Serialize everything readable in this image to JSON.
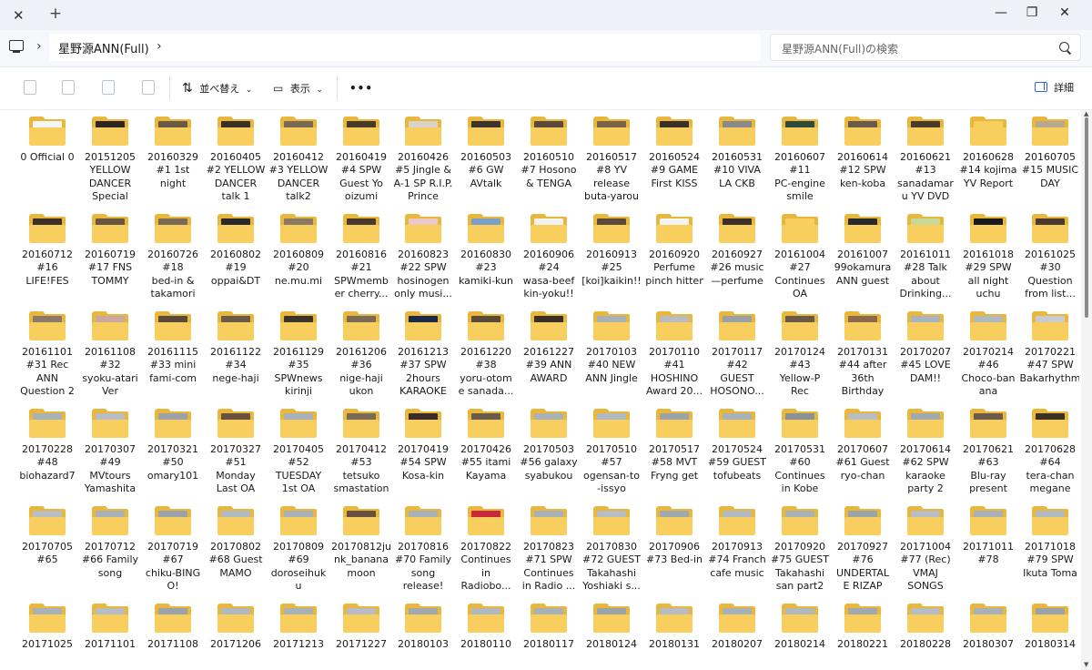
{
  "window": {
    "tab_close_icon": "close-icon",
    "new_tab_icon": "plus-icon",
    "minimize_icon": "minimize-icon",
    "restore_icon": "restore-icon",
    "close_icon": "close-icon"
  },
  "address": {
    "breadcrumb": "星野源ANN(Full)",
    "search_placeholder": "星野源ANN(Full)の検索"
  },
  "toolbar": {
    "sort_label": "並べ替え",
    "view_label": "表示",
    "more_label": "•••",
    "details_label": "詳細"
  },
  "rows": [
    [
      {
        "l": [
          "0 Official 0"
        ],
        "c": "#f6f6f6"
      },
      {
        "l": [
          "20151205",
          "YELLOW",
          "DANCER",
          "Special"
        ],
        "c": "#2c2620"
      },
      {
        "l": [
          "20160329",
          "#1  1st",
          "night"
        ],
        "c": "#6a5a45"
      },
      {
        "l": [
          "20160405",
          "#2 YELLOW",
          "DANCER",
          "talk 1"
        ],
        "c": "#3a3028"
      },
      {
        "l": [
          "20160412",
          "#3 YELLOW",
          "DANCER",
          "talk2"
        ],
        "c": "#7a6a55"
      },
      {
        "l": [
          "20160419",
          "#4 SPW",
          "Guest Yo",
          "oizumi"
        ],
        "c": "#4a3a2a"
      },
      {
        "l": [
          "20160426",
          "#5 Jingle &",
          "A-1 SP R.I.P.",
          "Prince"
        ],
        "c": "#d8d2c8"
      },
      {
        "l": [
          "20160503",
          "#6 GW",
          "AVtalk"
        ],
        "c": "#3a342c"
      },
      {
        "l": [
          "20160510",
          "#7  Hosono",
          "& TENGA"
        ],
        "c": "#5a4a3a"
      },
      {
        "l": [
          "20160517",
          "#8  YV",
          "release",
          "buta-yarou"
        ],
        "c": "#7a6548"
      },
      {
        "l": [
          "20160524",
          "#9  GAME",
          "First KISS"
        ],
        "c": "#3a3028"
      },
      {
        "l": [
          "20160531",
          "#10 VIVA",
          "LA  CKB"
        ],
        "c": "#8a8a8a"
      },
      {
        "l": [
          "20160607",
          "#11",
          "PC-engine",
          "smile"
        ],
        "c": "#2e4a3a"
      },
      {
        "l": [
          "20160614",
          "#12 SPW",
          "ken-koba"
        ],
        "c": "#6a5a4a"
      },
      {
        "l": [
          "20160621",
          "#13",
          "sanadamar",
          "u YV DVD"
        ],
        "c": "#4a3a2c"
      },
      {
        "l": [
          "20160628",
          "#14 kojima",
          "YV Report"
        ],
        "c": "#f8cf5e"
      },
      {
        "l": [
          "20160705",
          "#15  MUSIC",
          "DAY"
        ],
        "c": "#b8a890"
      }
    ],
    [
      {
        "l": [
          "20160712",
          "#16",
          "LIFE!FES"
        ],
        "c": "#3a3026"
      },
      {
        "l": [
          "20160719",
          "#17   FNS",
          "TOMMY"
        ],
        "c": "#6a5540"
      },
      {
        "l": [
          "20160726",
          "#18",
          "bed-in &",
          "takamori"
        ],
        "c": "#7a6a55"
      },
      {
        "l": [
          "20160802",
          "#19",
          "oppai&DT"
        ],
        "c": "#2a2a2a"
      },
      {
        "l": [
          "20160809",
          "#20",
          "ne.mu.mi"
        ],
        "c": "#8a7a65"
      },
      {
        "l": [
          "20160816",
          "#21",
          "SPWmemb",
          "er  cherry..."
        ],
        "c": "#4a3a2e"
      },
      {
        "l": [
          "20160823",
          "#22 SPW",
          "hosinogen",
          "only musi..."
        ],
        "c": "#e8c8c8"
      },
      {
        "l": [
          "20160830",
          "#23",
          "kamiki-kun"
        ],
        "c": "#7aa0c8"
      },
      {
        "l": [
          "20160906",
          "#24",
          "wasa-beef",
          "kin-yoku!!"
        ],
        "c": "#f2f2f2"
      },
      {
        "l": [
          "20160913",
          "#25",
          "[koi]kaikin!!"
        ],
        "c": "#5a4a3a"
      },
      {
        "l": [
          "20160920",
          "Perfume",
          "pinch hitter"
        ],
        "c": "#f4f4f4"
      },
      {
        "l": [
          "20160927",
          "#26  music",
          "—perfume"
        ],
        "c": "#3a3028"
      },
      {
        "l": [
          "20161004",
          "#27",
          "Continues",
          "OA"
        ],
        "c": "#f8cf5e"
      },
      {
        "l": [
          "20161007",
          "99okamura",
          "ANN  guest"
        ],
        "c": "#2a2a2a"
      },
      {
        "l": [
          "20161011",
          "#28 Talk",
          "about",
          "Drinking..."
        ],
        "c": "#c8d898"
      },
      {
        "l": [
          "20161018",
          "#29   SPW",
          "all night",
          "uchu"
        ],
        "c": "#1a1a1a"
      },
      {
        "l": [
          "20161025",
          "#30",
          "Question",
          "from list..."
        ],
        "c": "#4a3a30"
      }
    ],
    [
      {
        "l": [
          "20161101",
          "#31     Rec",
          "ANN",
          "Question 2"
        ],
        "c": "#8a7a68"
      },
      {
        "l": [
          "20161108",
          "#32",
          "syoku-atari",
          "Ver"
        ],
        "c": "#c8a8a0"
      },
      {
        "l": [
          "20161115",
          "#33  mini",
          "fami-com"
        ],
        "c": "#5a4a3a"
      },
      {
        "l": [
          "20161122",
          "#34",
          "nege-haji"
        ],
        "c": "#6a5a48"
      },
      {
        "l": [
          "20161129",
          "#35",
          "SPWnews",
          "kirinji"
        ],
        "c": "#3a342c"
      },
      {
        "l": [
          "20161206",
          "#36",
          "nige-haji",
          "ukon"
        ],
        "c": "#7a6a58"
      },
      {
        "l": [
          "20161213",
          "#37  SPW",
          "2hours",
          "KARAOKE"
        ],
        "c": "#1a2a4a"
      },
      {
        "l": [
          "20161220",
          "#38",
          "yoru-otom",
          "e sanada..."
        ],
        "c": "#5a4a3a"
      },
      {
        "l": [
          "20161227",
          "#39  ANN",
          "AWARD"
        ],
        "c": "#3a3026"
      },
      {
        "l": [
          "20170103",
          "#40  NEW",
          "ANN Jingle"
        ],
        "c": "#a8b0b8"
      },
      {
        "l": [
          "20170110",
          "#41",
          "HOSHINO",
          "Award 20..."
        ],
        "c": "#b8bcc0"
      },
      {
        "l": [
          "20170117",
          "#42",
          "GUEST",
          "HOSONO..."
        ],
        "c": "#9aa0a8"
      },
      {
        "l": [
          "20170124",
          "#43",
          "Yellow-P",
          "Rec"
        ],
        "c": "#6a5a4a"
      },
      {
        "l": [
          "20170131",
          "#44  after",
          "36th",
          "Birthday"
        ],
        "c": "#8a6a4a"
      },
      {
        "l": [
          "20170207",
          "#45  LOVE",
          "DAM!!"
        ],
        "c": "#a8b4c0"
      },
      {
        "l": [
          "20170214",
          "#46",
          "Choco-ban",
          "ana"
        ],
        "c": "#b0b8c0"
      },
      {
        "l": [
          "20170221",
          "#47  SPW",
          "Bakarhythm"
        ],
        "c": "#c8ccd2"
      }
    ],
    [
      {
        "l": [
          "20170228",
          "#48",
          "biohazard7"
        ],
        "c": "#a8b0b8"
      },
      {
        "l": [
          "20170307",
          "#49",
          "MVtours",
          "Yamashita"
        ],
        "c": "#b8bcc4"
      },
      {
        "l": [
          "20170321",
          "#50",
          "omary101"
        ],
        "c": "#9aa2aa"
      },
      {
        "l": [
          "20170327",
          "#51",
          "Monday",
          "Last OA"
        ],
        "c": "#6a5040"
      },
      {
        "l": [
          "20170405",
          "#52",
          "TUESDAY",
          "1st OA"
        ],
        "c": "#a8b0b8"
      },
      {
        "l": [
          "20170412",
          "#53",
          "tetsuko",
          "smastation"
        ],
        "c": "#7a6a58"
      },
      {
        "l": [
          "20170419",
          "#54  SPW",
          "Kosa-kin"
        ],
        "c": "#3a2a2a"
      },
      {
        "l": [
          "20170426",
          "#55  itami",
          "Kayama"
        ],
        "c": "#6a5a4a"
      },
      {
        "l": [
          "20170503",
          "#56  galaxy",
          "syabukou"
        ],
        "c": "#a8b0b8"
      },
      {
        "l": [
          "20170510",
          "#57",
          "ogensan-to",
          "-issyo"
        ],
        "c": "#b0b8c0"
      },
      {
        "l": [
          "20170517",
          "#58  MVT",
          "Fryng get"
        ],
        "c": "#9aa2aa"
      },
      {
        "l": [
          "20170524",
          "#59  GUEST",
          "tofubeats"
        ],
        "c": "#a8b0b8"
      },
      {
        "l": [
          "20170531",
          "#60",
          "Continues",
          "in Kobe"
        ],
        "c": "#8a9098"
      },
      {
        "l": [
          "20170607",
          "#61 Guest",
          "ryo-chan"
        ],
        "c": "#b8bcc4"
      },
      {
        "l": [
          "20170614",
          "#62 SPW",
          "karaoke",
          "party 2"
        ],
        "c": "#a0a8b0"
      },
      {
        "l": [
          "20170621",
          "#63",
          "Blu-ray",
          "present"
        ],
        "c": "#6a5a4a"
      },
      {
        "l": [
          "20170628",
          "#64",
          "tera-chan",
          "megane"
        ],
        "c": "#3a3026"
      }
    ],
    [
      {
        "l": [
          "20170705",
          "#65"
        ],
        "c": "#b8bcc4"
      },
      {
        "l": [
          "20170712",
          "#66 Family",
          "song"
        ],
        "c": "#a8b0b8"
      },
      {
        "l": [
          "20170719",
          "#67",
          "chiku-BING",
          "O!"
        ],
        "c": "#9aa2aa"
      },
      {
        "l": [
          "20170802",
          "#68 Guest",
          "MAMO"
        ],
        "c": "#b0b8c0"
      },
      {
        "l": [
          "20170809",
          "#69",
          "doroseihuk",
          "u"
        ],
        "c": "#a8b0b8"
      },
      {
        "l": [
          "20170812ju",
          "nk_banana",
          "moon"
        ],
        "c": "#6a5040"
      },
      {
        "l": [
          "20170816",
          "#70  Family",
          "song",
          "release!"
        ],
        "c": "#a8b0b8"
      },
      {
        "l": [
          "20170822",
          "Continues",
          "in",
          "Radiobo..."
        ],
        "c": "#c8283a"
      },
      {
        "l": [
          "20170823",
          "#71 SPW",
          "Continues",
          "in Radio ..."
        ],
        "c": "#a8b0b8"
      },
      {
        "l": [
          "20170830",
          "#72  GUEST",
          "Takahashi",
          "Yoshiaki s..."
        ],
        "c": "#b8bcc4"
      },
      {
        "l": [
          "20170906",
          "#73 Bed-in"
        ],
        "c": "#a0a8b0"
      },
      {
        "l": [
          "20170913",
          "#74 Franch",
          "cafe music"
        ],
        "c": "#b0b8c0"
      },
      {
        "l": [
          "20170920",
          "#75 GUEST",
          "Takahashi",
          "san part2"
        ],
        "c": "#a8b0b8"
      },
      {
        "l": [
          "20170927",
          "#76",
          "UNDERTAL",
          "E RIZAP"
        ],
        "c": "#9aa2aa"
      },
      {
        "l": [
          "20171004",
          "#77  (Rec)",
          "VMAJ",
          "SONGS"
        ],
        "c": "#b8bcc4"
      },
      {
        "l": [
          "20171011",
          "#78"
        ],
        "c": "#a8b0b8"
      },
      {
        "l": [
          "20171018",
          "#79  SPW",
          "Ikuta Toma"
        ],
        "c": "#b0b8c0"
      }
    ],
    [
      {
        "l": [
          "20171025"
        ],
        "c": "#a8b0b8"
      },
      {
        "l": [
          "20171101"
        ],
        "c": "#b8bcc4"
      },
      {
        "l": [
          "20171108"
        ],
        "c": "#9aa2aa"
      },
      {
        "l": [
          "20171206"
        ],
        "c": "#b0b8c0"
      },
      {
        "l": [
          "20171213"
        ],
        "c": "#a8b0b8"
      },
      {
        "l": [
          "20171227"
        ],
        "c": "#b8bcc4"
      },
      {
        "l": [
          "20180103"
        ],
        "c": "#a0a8b0"
      },
      {
        "l": [
          "20180110"
        ],
        "c": "#b0b8c0"
      },
      {
        "l": [
          "20180117"
        ],
        "c": "#a8b0b8"
      },
      {
        "l": [
          "20180124"
        ],
        "c": "#9aa2aa"
      },
      {
        "l": [
          "20180131"
        ],
        "c": "#b8bcc4"
      },
      {
        "l": [
          "20180207"
        ],
        "c": "#a8b0b8"
      },
      {
        "l": [
          "20180214"
        ],
        "c": "#b0b8c0"
      },
      {
        "l": [
          "20180221"
        ],
        "c": "#a0a8b0"
      },
      {
        "l": [
          "20180228"
        ],
        "c": "#b8bcc4"
      },
      {
        "l": [
          "20180307"
        ],
        "c": "#a8b0b8"
      },
      {
        "l": [
          "20180314"
        ],
        "c": "#9aa2aa"
      }
    ]
  ]
}
